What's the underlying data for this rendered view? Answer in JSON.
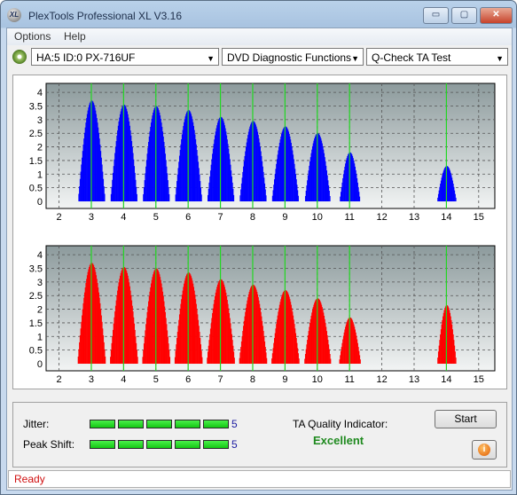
{
  "window": {
    "title": "PlexTools Professional XL V3.16",
    "icon_label": "XL",
    "min_glyph": "▭",
    "max_glyph": "▢",
    "close_glyph": "✕"
  },
  "menu": [
    "Options",
    "Help"
  ],
  "toolbar": {
    "drive": "HA:5 ID:0  PX-716UF",
    "function": "DVD Diagnostic Functions",
    "test": "Q-Check TA Test",
    "arrow": "▼"
  },
  "chart_data": [
    {
      "type": "bar",
      "title": "",
      "series": [
        {
          "color": "#0000ff"
        }
      ],
      "x_ticks": [
        2,
        3,
        4,
        5,
        6,
        7,
        8,
        9,
        10,
        11,
        12,
        13,
        14,
        15
      ],
      "y_ticks": [
        0,
        0.5,
        1,
        1.5,
        2,
        2.5,
        3,
        3.5,
        4
      ],
      "xlim": [
        1.6,
        15.5
      ],
      "ylim": [
        0,
        4.2
      ],
      "peaks": [
        {
          "center": 3.0,
          "height": 3.7,
          "width": 0.42
        },
        {
          "center": 4.0,
          "height": 3.55,
          "width": 0.42
        },
        {
          "center": 5.0,
          "height": 3.5,
          "width": 0.42
        },
        {
          "center": 6.0,
          "height": 3.35,
          "width": 0.42
        },
        {
          "center": 7.0,
          "height": 3.1,
          "width": 0.42
        },
        {
          "center": 8.0,
          "height": 2.95,
          "width": 0.42
        },
        {
          "center": 9.0,
          "height": 2.75,
          "width": 0.42
        },
        {
          "center": 10.0,
          "height": 2.5,
          "width": 0.4
        },
        {
          "center": 11.0,
          "height": 1.8,
          "width": 0.32
        },
        {
          "center": 14.0,
          "height": 1.3,
          "width": 0.3
        }
      ],
      "reference_lines": [
        3,
        4,
        5,
        6,
        7,
        8,
        9,
        10,
        11,
        14
      ]
    },
    {
      "type": "bar",
      "title": "",
      "series": [
        {
          "color": "#ff0000"
        }
      ],
      "x_ticks": [
        2,
        3,
        4,
        5,
        6,
        7,
        8,
        9,
        10,
        11,
        12,
        13,
        14,
        15
      ],
      "y_ticks": [
        0,
        0.5,
        1,
        1.5,
        2,
        2.5,
        3,
        3.5,
        4
      ],
      "xlim": [
        1.6,
        15.5
      ],
      "ylim": [
        0,
        4.2
      ],
      "peaks": [
        {
          "center": 3.0,
          "height": 3.7,
          "width": 0.44
        },
        {
          "center": 4.0,
          "height": 3.55,
          "width": 0.44
        },
        {
          "center": 5.0,
          "height": 3.5,
          "width": 0.44
        },
        {
          "center": 6.0,
          "height": 3.35,
          "width": 0.44
        },
        {
          "center": 7.0,
          "height": 3.1,
          "width": 0.44
        },
        {
          "center": 8.0,
          "height": 2.9,
          "width": 0.44
        },
        {
          "center": 9.0,
          "height": 2.7,
          "width": 0.44
        },
        {
          "center": 10.0,
          "height": 2.4,
          "width": 0.42
        },
        {
          "center": 11.0,
          "height": 1.7,
          "width": 0.34
        },
        {
          "center": 14.0,
          "height": 2.15,
          "width": 0.3
        }
      ],
      "reference_lines": [
        3,
        4,
        5,
        6,
        7,
        8,
        9,
        10,
        11,
        14
      ]
    }
  ],
  "status": {
    "jitter_label": "Jitter:",
    "jitter_value": "5",
    "jitter_level": 5,
    "peak_label": "Peak Shift:",
    "peak_value": "5",
    "peak_level": 5,
    "ta_label": "TA Quality Indicator:",
    "ta_value": "Excellent",
    "start_button": "Start",
    "info_glyph": "i"
  },
  "statusbar": {
    "text": "Ready"
  }
}
